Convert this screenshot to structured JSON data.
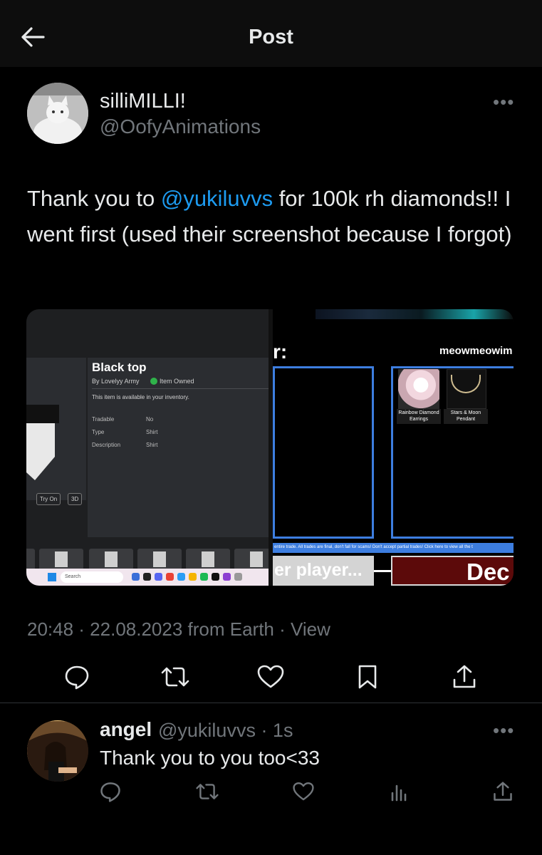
{
  "header": {
    "title": "Post",
    "back_icon": "arrow-left-icon"
  },
  "tweet": {
    "author": {
      "display_name": "silliMILLI!",
      "handle": "@OofyAnimations"
    },
    "more_label": "•••",
    "text_before": "Thank you to ",
    "mention": "@yukiluvvs",
    "text_after": " for 100k rh diamonds!! I went first (used their screenshot because I forgot)",
    "media": {
      "left": {
        "title": "Black top",
        "by": "By Lovelyy Army",
        "owned": "Item Owned",
        "available": "This item is available in your inventory.",
        "rows": [
          {
            "label": "Tradable",
            "value": "No"
          },
          {
            "label": "Type",
            "value": "Shirt"
          },
          {
            "label": "Description",
            "value": "Shirt"
          }
        ],
        "buttons": [
          "Try On",
          "3D"
        ],
        "search_placeholder": "Search"
      },
      "right": {
        "title_fragment": "r:",
        "username": "meowmeowim",
        "items": [
          {
            "label": "Rainbow Diamond Earrings"
          },
          {
            "label": "Stars & Moon Pendant"
          }
        ],
        "banner": "entire trade. All trades are final, don't fall for scams! Don't accept partial trades! Click here to view all the t",
        "bottom_left": "er player...",
        "bottom_right": "Dec"
      }
    },
    "meta": "20:48 · 22.08.2023 from Earth · View",
    "actions": [
      "reply-icon",
      "retweet-icon",
      "like-icon",
      "bookmark-icon",
      "share-icon"
    ]
  },
  "reply": {
    "display_name": "angel",
    "handle": "@yukiluvvs · 1s",
    "more_label": "•••",
    "text": "Thank you to you too<33",
    "actions": [
      "reply-icon",
      "retweet-icon",
      "like-icon",
      "views-icon",
      "share-icon"
    ]
  },
  "colors": {
    "accent": "#1d9bf0",
    "muted": "#71767b",
    "text": "#e7e9ea",
    "background": "#000000"
  }
}
